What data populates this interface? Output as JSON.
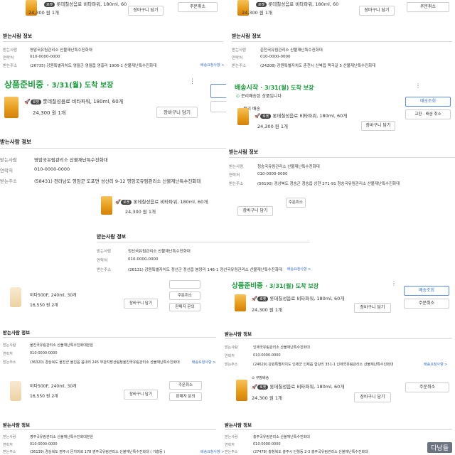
{
  "product_rocket": "롯데칠성음료 비타파워, 180ml, 60개",
  "product_rocket_trunc": "롯데칠성음료 비타파워, 180ml, 60",
  "product_vita500": "비타500F, 240ml, 30개",
  "price_24300": "24,300 원   1개",
  "price_16550": "16,550 원   2개",
  "cart_btn": "장바구니 담기",
  "order_cancel": "주문취소",
  "delivery_check": "배송조회",
  "exchange_return": "교환 · 배송 취소",
  "inquiry": "판매자 문의",
  "recipient_section": "받는사람 정보",
  "label_recipient": "받는사람",
  "label_contact": "연락처",
  "label_address": "받는주소",
  "contact_value": "010-0000-0000",
  "edit_link": "배송요청사항 >",
  "status_prep": "상품준비중",
  "status_shipping": "배송시작",
  "date_text": "· 3/31(월) 도착 보장",
  "separate_shipping_note": "분리배송된 상품입니다",
  "split_label": "분리 배송",
  "rocket_badge": "로켓",
  "rocket_mark": "쿠팡배송",
  "rec_yeongam": "영암국유림관리소 산불재난특수진화대",
  "addr_yeongam": "(58431) 전라남도 영암군 도포면 성산리 9-12 영암국유림관리소 산불재난특수진화대",
  "rec_jeongseon": "정선국유림관리소 산불재난특수진화대",
  "addr_jeongseon": "(26131) 강원특별자치도 정선군 정선읍 봉양리 146-1 정선국유림관리소 산불재난특수진화대",
  "rec_chuncheon": "춘천국유림관리소 산불재난특수진화대",
  "addr_chuncheon": "(24208) 강원특별자치도 춘천시 신북읍 맥국길 5 산불재난특수진화대",
  "rec_cheongsong": "청송국유림관리소 산불재난특수진화대",
  "addr_cheongsong": "(56190) 경상북도 청송군 청송읍 상현 271-91 청송국유림관리소 산불재난특수진화대",
  "rec_uljin": "울진국유림관리소 산불재난특수진화대본원",
  "addr_uljin": "(36320) 경상북도 울진군 울진읍 읍내리 245 부관지방산림청울진국유림관리소 산불재난특수진화대",
  "rec_inje": "인제국유림관리소 산불재난특수진화대",
  "addr_inje": "(24629) 강원특별자치도 인제군 인제읍 합강리 351-1 인제국유림관리소 산불재난특수진화대",
  "rec_yeongju": "영주국유림관리소 산불재난특수진화대본원",
  "addr_yeongju": "(36139) 경상북도 영주시 문치미로 178 영주국유림관리소 산불재난특수진화대 ( 가흥동 )",
  "rec_chungju": "충주국유림관리소 산불재난특수진화대",
  "addr_chungju": "(27478) 충청북도 충주시 단월동 2-3 충주국유림관리소 산불재난특수진화대",
  "addr_top_left": "(26735) 강원특별자치도 영월군 영월읍 영흥리 1906-1 산불재난특수진화대",
  "watermark": "다낭들"
}
